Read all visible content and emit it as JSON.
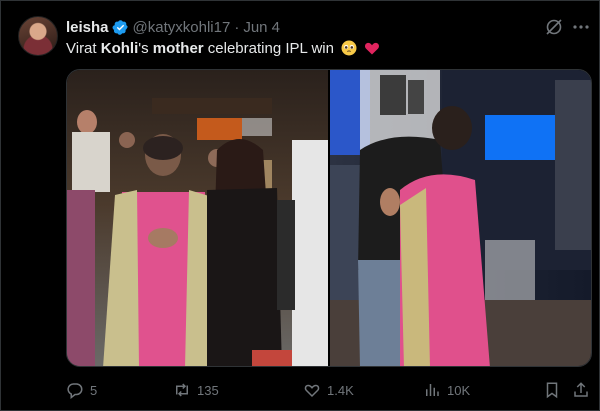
{
  "author": {
    "name": "leisha",
    "handle": "@katyxkohli17",
    "separator": "·",
    "date": "Jun 4",
    "verified": true
  },
  "tweet": {
    "text_parts": [
      {
        "text": "Virat ",
        "bold": false
      },
      {
        "text": "Kohli",
        "bold": true
      },
      {
        "text": "'s ",
        "bold": false
      },
      {
        "text": "mother",
        "bold": true
      },
      {
        "text": " celebrating IPL win",
        "bold": false
      }
    ],
    "emojis": [
      "pleading-face-emoji",
      "red-heart-emoji"
    ]
  },
  "media": {
    "photos": [
      {
        "name": "celebration-photo-left"
      },
      {
        "name": "hug-photo-right"
      }
    ]
  },
  "actions": {
    "replies": "5",
    "reposts": "135",
    "likes": "1.4K",
    "views": "10K"
  },
  "icons": {
    "verified": "verified-badge-icon",
    "grok": "grok-icon",
    "more": "more-icon",
    "reply": "reply-icon",
    "repost": "repost-icon",
    "like": "heart-icon",
    "views": "views-icon",
    "bookmark": "bookmark-icon",
    "share": "share-icon"
  },
  "colors": {
    "background": "#000000",
    "text": "#e7e9ea",
    "muted": "#71767b",
    "verified": "#1d9bf0",
    "heart_emoji": "#e0245e"
  }
}
